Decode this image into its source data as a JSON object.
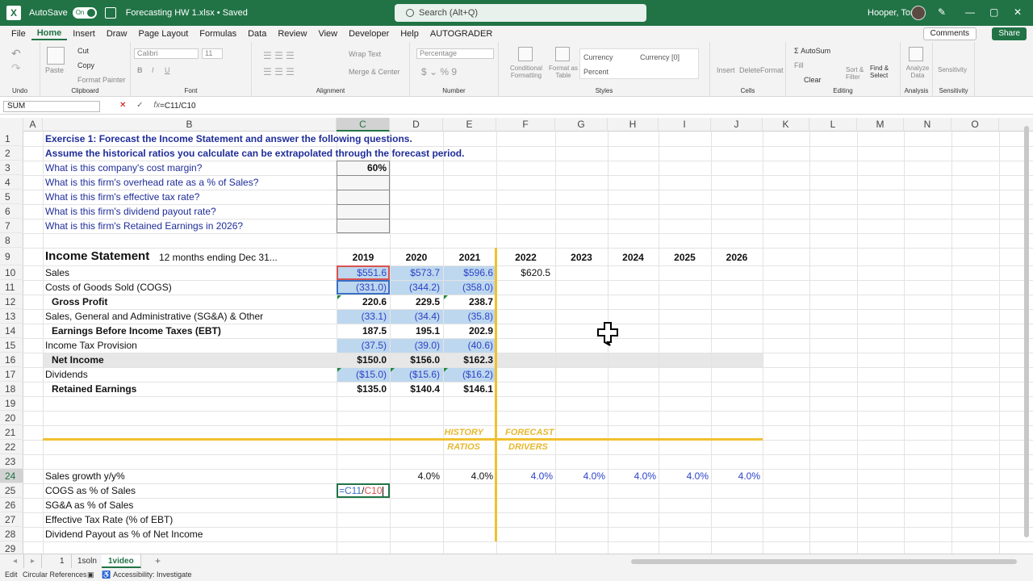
{
  "titlebar": {
    "app_logo": "X",
    "autosave_label": "AutoSave",
    "autosave_state": "On",
    "filename": "Forecasting HW 1.xlsx • Saved",
    "search_placeholder": "Search (Alt+Q)",
    "user": "Hooper, Tom",
    "minimize": "—",
    "restore": "▢",
    "close": "✕"
  },
  "menu": {
    "items": [
      "File",
      "Home",
      "Insert",
      "Draw",
      "Page Layout",
      "Formulas",
      "Data",
      "Review",
      "View",
      "Developer",
      "Help",
      "AUTOGRADER"
    ],
    "active": "Home",
    "comments": "Comments",
    "share": "Share"
  },
  "ribbon": {
    "undo_label": "Undo",
    "clipboard": {
      "label": "Clipboard",
      "paste": "Paste",
      "cut": "Cut",
      "copy": "Copy",
      "format_painter": "Format Painter"
    },
    "font": {
      "label": "Font",
      "name": "Calibri",
      "size": "11"
    },
    "alignment": {
      "label": "Alignment",
      "wrap": "Wrap Text",
      "merge": "Merge & Center"
    },
    "number": {
      "label": "Number",
      "format": "Percentage"
    },
    "styles": {
      "label": "Styles",
      "cond": "Conditional Formatting",
      "format_table": "Format as Table",
      "currency": "Currency",
      "currency0": "Currency [0]",
      "percent": "Percent"
    },
    "cells": {
      "label": "Cells",
      "insert": "Insert",
      "delete": "Delete",
      "format": "Format"
    },
    "editing": {
      "label": "Editing",
      "autosum": "AutoSum",
      "fill": "Fill",
      "clear": "Clear",
      "sort": "Sort & Filter",
      "find": "Find & Select"
    },
    "analysis": {
      "label": "Analysis",
      "analyze": "Analyze Data"
    },
    "sensitivity": {
      "label": "Sensitivity",
      "btn": "Sensitivity"
    }
  },
  "formula_bar": {
    "name_box": "SUM",
    "cancel": "✕",
    "enter": "✓",
    "fx": "fx",
    "formula": "=C11/C10"
  },
  "columns": [
    "A",
    "B",
    "C",
    "D",
    "E",
    "F",
    "G",
    "H",
    "I",
    "J",
    "K",
    "L",
    "M",
    "N",
    "O"
  ],
  "rows": [
    "1",
    "2",
    "3",
    "4",
    "5",
    "6",
    "7",
    "8",
    "9",
    "10",
    "11",
    "12",
    "13",
    "14",
    "15",
    "16",
    "17",
    "18",
    "19",
    "20",
    "21",
    "22",
    "23",
    "24",
    "25",
    "26",
    "27",
    "28",
    "29"
  ],
  "questions": {
    "title1": "Exercise 1:  Forecast the Income Statement and answer the following questions.",
    "title2": "Assume the historical ratios you calculate can be extrapolated through the forecast period.",
    "q1": "What is this company's cost margin?",
    "q2": "What is this firm's overhead rate as a % of Sales?",
    "q3": "What is this firm's effective tax rate?",
    "q4": "What is this firm's dividend payout rate?",
    "q5": "What is this firm's Retained Earnings in 2026?",
    "a1": "60%"
  },
  "income": {
    "heading": "Income Statement",
    "subheading": "12 months ending Dec 31...",
    "years": [
      "2019",
      "2020",
      "2021",
      "2022",
      "2023",
      "2024",
      "2025",
      "2026"
    ],
    "sales_label": "Sales",
    "sales": [
      "$551.6",
      "$573.7",
      "$596.6",
      "$620.5"
    ],
    "cogs_label": "Costs of Goods Sold (COGS)",
    "cogs": [
      "(331.0)",
      "(344.2)",
      "(358.0)"
    ],
    "gp_label": "Gross Profit",
    "gp": [
      "220.6",
      "229.5",
      "238.7"
    ],
    "sga_label": "Sales, General and Administrative (SG&A) & Other",
    "sga": [
      "(33.1)",
      "(34.4)",
      "(35.8)"
    ],
    "ebt_label": "Earnings Before Income Taxes (EBT)",
    "ebt": [
      "187.5",
      "195.1",
      "202.9"
    ],
    "tax_label": "Income Tax Provision",
    "tax": [
      "(37.5)",
      "(39.0)",
      "(40.6)"
    ],
    "ni_label": "Net Income",
    "ni": [
      "$150.0",
      "$156.0",
      "$162.3"
    ],
    "div_label": "Dividends",
    "div": [
      "($15.0)",
      "($15.6)",
      "($16.2)"
    ],
    "re_label": "Retained Earnings",
    "re": [
      "$135.0",
      "$140.4",
      "$146.1"
    ]
  },
  "ratios": {
    "history1": "HISTORY",
    "history2": "RATIOS",
    "forecast1": "FORECAST",
    "forecast2": "DRIVERS",
    "growth_label": "Sales growth y/y%",
    "growth_hist": [
      "4.0%",
      "4.0%"
    ],
    "growth_fc": [
      "4.0%",
      "4.0%",
      "4.0%",
      "4.0%",
      "4.0%"
    ],
    "cogs_label": "COGS as % of Sales",
    "cogs_edit_a": "=C11",
    "cogs_edit_b": "/",
    "cogs_edit_c": "C10",
    "sga_label": "SG&A as % of Sales",
    "tax_label": "Effective Tax Rate (% of EBT)",
    "div_label": "Dividend Payout as % of Net Income"
  },
  "sheets": {
    "tabs": [
      "1",
      "1soln",
      "1video"
    ],
    "active": "1video",
    "add": "+"
  },
  "status": {
    "mode": "Edit",
    "circ": "Circular References",
    "access": "Accessibility: Investigate"
  },
  "colors": {
    "excel_green": "#217346",
    "input_blue": "#2b42c8",
    "label_navy": "#1f2d99",
    "divider_gold": "#f0c030",
    "hist_fill": "#bdd7ee"
  }
}
